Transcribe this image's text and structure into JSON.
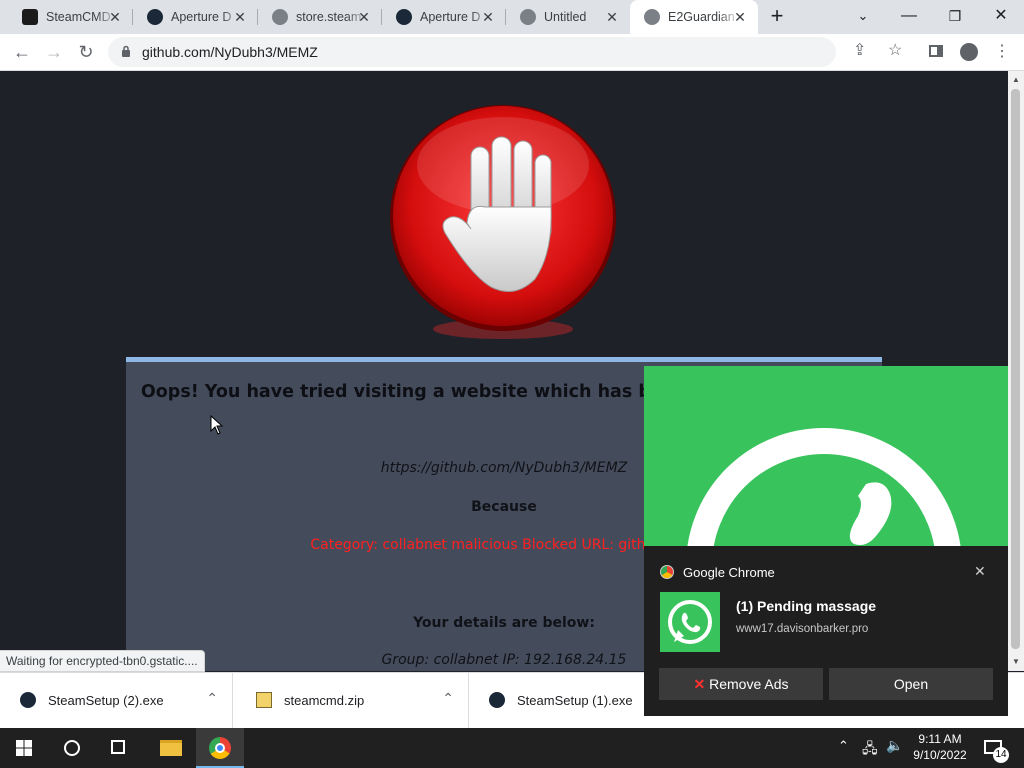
{
  "browser": {
    "tabs": [
      {
        "title": "SteamCMD",
        "icon": "steam-db-icon"
      },
      {
        "title": "Aperture D",
        "icon": "steam-icon"
      },
      {
        "title": "store.steam",
        "icon": "globe-icon"
      },
      {
        "title": "Aperture D",
        "icon": "steam-icon"
      },
      {
        "title": "Untitled",
        "icon": "globe-icon"
      },
      {
        "title": "E2Guardian",
        "icon": "globe-icon",
        "active": true
      }
    ],
    "url": "github.com/NyDubh3/MEMZ",
    "status": "Waiting for encrypted-tbn0.gstatic...."
  },
  "block_page": {
    "heading": "Oops! You have tried visiting a website which has been",
    "blocked_url": "https://github.com/NyDubh3/MEMZ",
    "because": "Because",
    "reason": "Category: collabnet malicious   Blocked URL: github.com",
    "details_heading": "Your details are below:",
    "details": "Group: collabnet    IP: 192.168.24.15",
    "accent": "#ff2020"
  },
  "downloads": [
    {
      "name": "SteamSetup (2).exe",
      "icon": "steam-icon"
    },
    {
      "name": "steamcmd.zip",
      "icon": "zip-icon"
    },
    {
      "name": "SteamSetup (1).exe",
      "icon": "steam-icon"
    }
  ],
  "notification": {
    "app": "Google Chrome",
    "title": "(1) Pending massage",
    "source": "www17.davisonbarker.pro",
    "remove_label": "Remove Ads",
    "open_label": "Open"
  },
  "taskbar": {
    "time": "9:11 AM",
    "date": "9/10/2022",
    "notification_count": "14"
  }
}
